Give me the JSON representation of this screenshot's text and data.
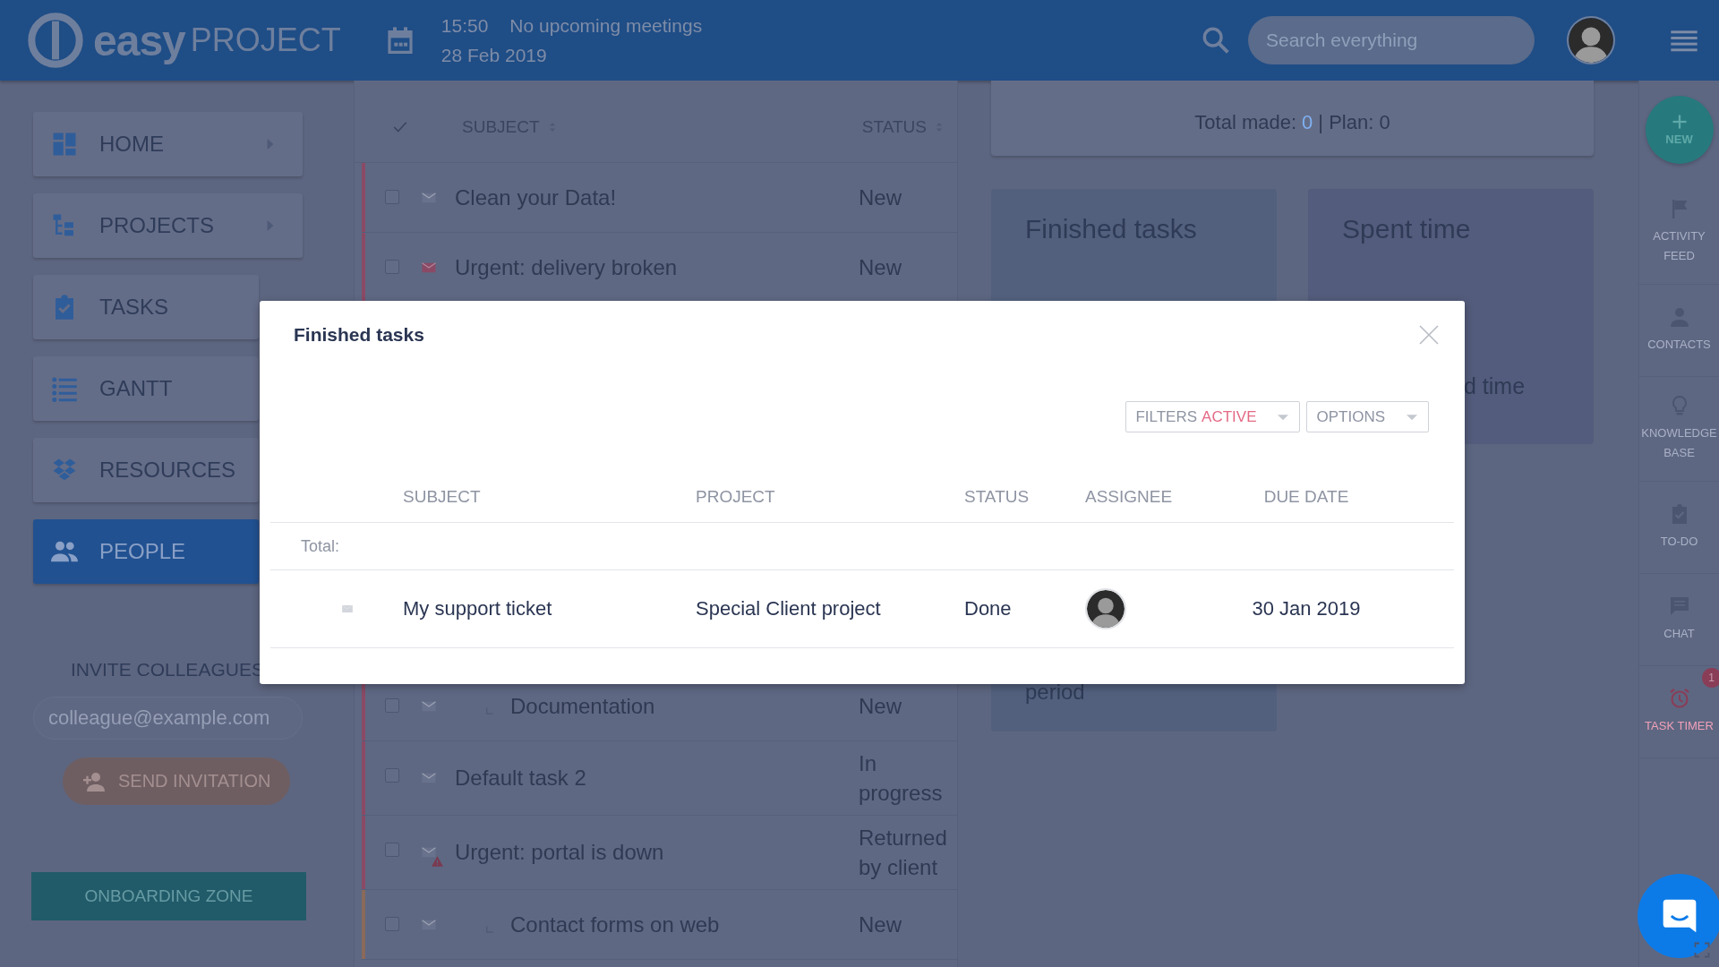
{
  "header": {
    "logo_bold": "easy",
    "logo_light": "PROJECT",
    "time": "15:50",
    "meetings": "No upcoming meetings",
    "date": "28 Feb 2019",
    "search": {
      "placeholder": "Search everything"
    }
  },
  "sidebar": {
    "items": [
      {
        "label": "HOME",
        "has_arrow": true,
        "selected": false
      },
      {
        "label": "PROJECTS",
        "has_arrow": true,
        "selected": false
      },
      {
        "label": "TASKS",
        "has_arrow": false,
        "selected": false
      },
      {
        "label": "GANTT",
        "has_arrow": false,
        "selected": false
      },
      {
        "label": "RESOURCES",
        "has_arrow": false,
        "selected": false
      },
      {
        "label": "PEOPLE",
        "has_arrow": false,
        "selected": true
      }
    ],
    "invite": {
      "title": "INVITE COLLEAGUES",
      "placeholder": "colleague@example.com",
      "button": "SEND INVITATION"
    },
    "onboarding": "ONBOARDING ZONE"
  },
  "task_list": {
    "columns": [
      "SUBJECT",
      "STATUS"
    ],
    "rows": [
      {
        "subject": "Clean your Data!",
        "status": "New",
        "kind": "task",
        "checked": false,
        "color": "#8a4a66"
      },
      {
        "subject": "Urgent: delivery broken",
        "status": "New",
        "kind": "urgent",
        "checked": false,
        "color": "#8a4a66"
      },
      {
        "subject": "Documentation",
        "status": "New",
        "kind": "subtask",
        "checked": false,
        "color": "#8a4a66"
      },
      {
        "subject": "Default task 2",
        "status": "In progress",
        "kind": "task",
        "checked": false,
        "color": "#8a4a66"
      },
      {
        "subject": "Urgent: portal is down",
        "status": "Returned by client",
        "kind": "alert",
        "checked": false,
        "color": "#8a4a66"
      },
      {
        "subject": "Contact forms on web",
        "status": "New",
        "kind": "subtask",
        "checked": false,
        "color": "#8a6a5a"
      }
    ]
  },
  "stats": {
    "total_made_label": "Total made:",
    "total_made_value": "0",
    "plan": "| Plan: 0",
    "cards": [
      {
        "kind": "finished",
        "title": "Finished tasks",
        "footer": "period"
      },
      {
        "kind": "spent",
        "title": "Spent time",
        "footer": "d time"
      }
    ]
  },
  "rail": {
    "new_button": "NEW",
    "items": [
      {
        "label": "ACTIVITY FEED",
        "alert": false
      },
      {
        "label": "CONTACTS",
        "alert": false
      },
      {
        "label": "KNOWLEDGE BASE",
        "alert": false
      },
      {
        "label": "TO-DO",
        "alert": false
      },
      {
        "label": "CHAT",
        "alert": false
      },
      {
        "label": "TASK TIMER",
        "alert": true,
        "badge": "1"
      }
    ]
  },
  "modal": {
    "title": "Finished tasks",
    "filters": {
      "label": "FILTERS",
      "state": "ACTIVE"
    },
    "options": "OPTIONS",
    "columns": [
      "SUBJECT",
      "PROJECT",
      "STATUS",
      "ASSIGNEE",
      "DUE DATE"
    ],
    "total_label": "Total:",
    "rows": [
      {
        "subject": "My support ticket",
        "project": "Special Client project",
        "status": "Done",
        "due_date": "30 Jan 2019"
      }
    ]
  }
}
